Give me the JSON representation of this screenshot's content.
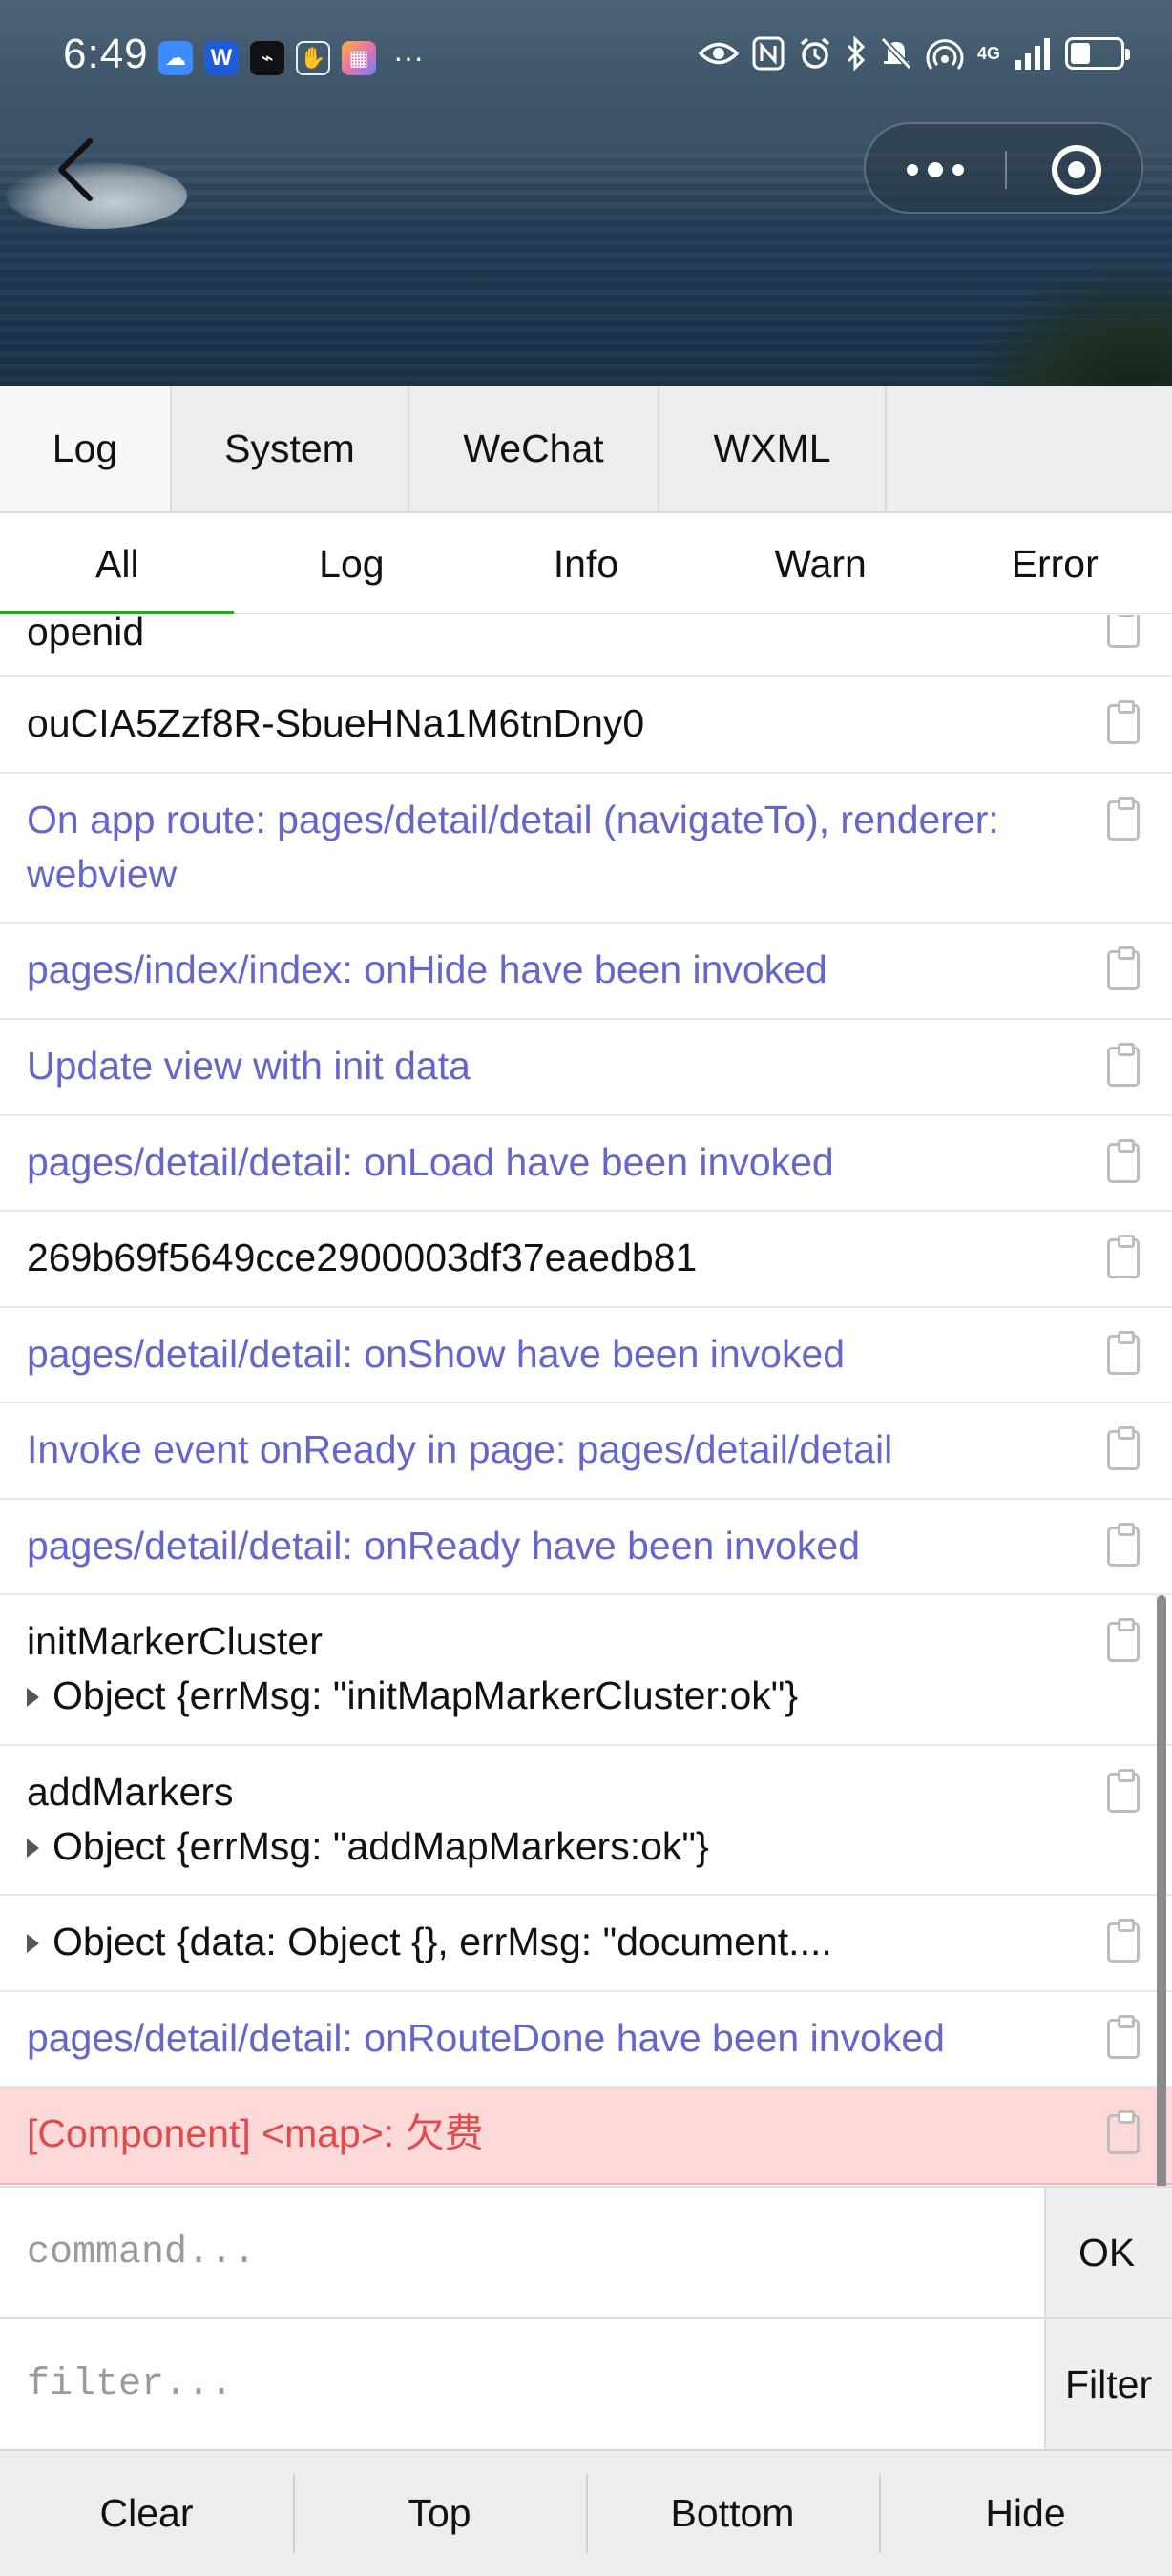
{
  "status_bar": {
    "time": "6:49",
    "apps": [
      {
        "icon": "cloud-app-icon",
        "color": "#3d8bfd",
        "glyph": "☁"
      },
      {
        "icon": "w-app-icon",
        "color": "#1e5bd6",
        "glyph": "W"
      },
      {
        "icon": "bird-app-icon",
        "color": "#111111",
        "glyph": "⌁"
      },
      {
        "icon": "hand-app-icon",
        "color": "#cfd6dc",
        "glyph": "✋"
      },
      {
        "icon": "color-app-icon",
        "color": "#e96fa9",
        "glyph": "▦"
      }
    ],
    "more_glyph": "···",
    "network_label": "4G",
    "battery_level": 0.35
  },
  "capsule": {
    "more_icon": "more-dots-icon",
    "close_icon": "close-miniprogram-icon"
  },
  "tabs": [
    {
      "label": "Log",
      "active": true
    },
    {
      "label": "System",
      "active": false
    },
    {
      "label": "WeChat",
      "active": false
    },
    {
      "label": "WXML",
      "active": false
    }
  ],
  "subtabs": [
    {
      "label": "All",
      "active": true
    },
    {
      "label": "Log",
      "active": false
    },
    {
      "label": "Info",
      "active": false
    },
    {
      "label": "Warn",
      "active": false
    },
    {
      "label": "Error",
      "active": false
    }
  ],
  "logs": [
    {
      "type": "plain",
      "text": "openid"
    },
    {
      "type": "plain",
      "text": "ouCIA5Zzf8R-SbueHNa1M6tnDny0"
    },
    {
      "type": "info",
      "text": "On app route: pages/detail/detail (navigateTo), renderer: webview"
    },
    {
      "type": "info",
      "text": "pages/index/index: onHide have been invoked"
    },
    {
      "type": "info",
      "text": "Update view with init data"
    },
    {
      "type": "info",
      "text": "pages/detail/detail: onLoad have been invoked"
    },
    {
      "type": "plain",
      "text": "269b69f5649cce2900003df37eaedb81"
    },
    {
      "type": "info",
      "text": "pages/detail/detail: onShow have been invoked"
    },
    {
      "type": "info",
      "text": "Invoke event onReady in page: pages/detail/detail"
    },
    {
      "type": "info",
      "text": "pages/detail/detail: onReady have been invoked"
    },
    {
      "type": "plain",
      "text": "initMarkerCluster",
      "object": "Object {errMsg: \"initMapMarkerCluster:ok\"}"
    },
    {
      "type": "plain",
      "text": "addMarkers",
      "object": "Object {errMsg: \"addMapMarkers:ok\"}"
    },
    {
      "type": "plain",
      "text": "",
      "object": "Object {data: Object {}, errMsg: \"document...."
    },
    {
      "type": "info",
      "text": "pages/detail/detail: onRouteDone have been invoked"
    },
    {
      "type": "error",
      "text": "[Component] <map>: 欠费"
    }
  ],
  "command": {
    "placeholder": "command...",
    "button": "OK"
  },
  "filter": {
    "placeholder": "filter...",
    "button": "Filter"
  },
  "toolbar": [
    "Clear",
    "Top",
    "Bottom",
    "Hide"
  ],
  "colors": {
    "info": "#6467c9",
    "error": "#e04b4b",
    "error_bg": "#fdd9d9",
    "active_underline": "#1aad19"
  }
}
